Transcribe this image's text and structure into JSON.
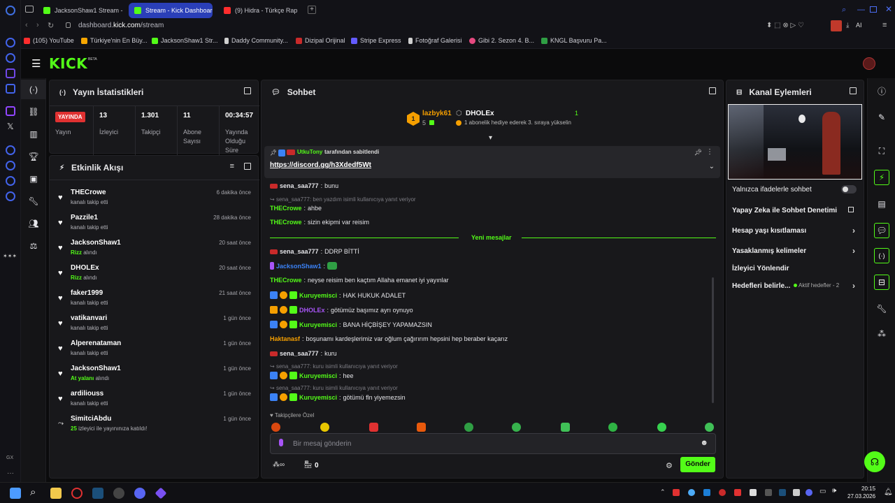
{
  "browser": {
    "tabs": [
      {
        "label": "JacksonShaw1 Stream - W",
        "fav_color": "#53fc18",
        "active": false
      },
      {
        "label": "Stream - Kick Dashboard",
        "fav_color": "#53fc18",
        "active": true
      },
      {
        "label": "(9) Hidra - Türkçe Rap",
        "fav_color": "#ff2d2d",
        "active": false
      }
    ],
    "url_prefix": "dashboard.",
    "url_domain": "kick.com",
    "url_path": "/stream",
    "bookmarks": [
      {
        "label": "(105) YouTube",
        "color": "#ff2d2d"
      },
      {
        "label": "Türkiye'nin En Büy...",
        "color": "#f7a600"
      },
      {
        "label": "JacksonShaw1 Str...",
        "color": "#53fc18"
      },
      {
        "label": "Daddy Community...",
        "color": "#d0d0d0"
      },
      {
        "label": "Dizipal Orijinal",
        "color": "#c92a2a"
      },
      {
        "label": "Stripe Express",
        "color": "#635bff"
      },
      {
        "label": "Fotoğraf Galerisi",
        "color": "#d0d0d0"
      },
      {
        "label": "Gibi 2. Sezon 4. B...",
        "color": "#e64980"
      },
      {
        "label": "KNGL Başvuru Pa...",
        "color": "#2f9e44"
      }
    ],
    "toolbar_ai": "AI"
  },
  "app": {
    "logo": "KICK",
    "logo_sup": "BETA"
  },
  "stats": {
    "title": "Yayın İstatistikleri",
    "live_badge": "YAYINDA",
    "live_label": "Yayın",
    "items": [
      {
        "value": "13",
        "label": "İzleyici"
      },
      {
        "value": "1.301",
        "label": "Takipçi"
      },
      {
        "value": "11",
        "label": "Abone Sayısı"
      },
      {
        "value": "00:34:57",
        "label": "Yayında Olduğu Süre"
      }
    ]
  },
  "activity": {
    "title": "Etkinlik Akışı",
    "items": [
      {
        "name": "THECrowe",
        "sub_pre": "",
        "sub_hl": "",
        "sub_post": "kanalı takip etti",
        "time": "6 dakika önce",
        "icon": "heart"
      },
      {
        "name": "Pazzile1",
        "sub_pre": "",
        "sub_hl": "",
        "sub_post": "kanalı takip etti",
        "time": "28 dakika önce",
        "icon": "heart"
      },
      {
        "name": "JacksonShaw1",
        "sub_pre": "",
        "sub_hl": "Rizz",
        "sub_post": " alındı",
        "time": "20 saat önce",
        "icon": "heart"
      },
      {
        "name": "DHOLEx",
        "sub_pre": "",
        "sub_hl": "Rizz",
        "sub_post": " alındı",
        "time": "20 saat önce",
        "icon": "heart"
      },
      {
        "name": "faker1999",
        "sub_pre": "",
        "sub_hl": "",
        "sub_post": "kanalı takip etti",
        "time": "21 saat önce",
        "icon": "heart"
      },
      {
        "name": "vatikanvari",
        "sub_pre": "",
        "sub_hl": "",
        "sub_post": "kanalı takip etti",
        "time": "1 gün önce",
        "icon": "heart"
      },
      {
        "name": "Alperenataman",
        "sub_pre": "",
        "sub_hl": "",
        "sub_post": "kanalı takip etti",
        "time": "1 gün önce",
        "icon": "heart"
      },
      {
        "name": "JacksonShaw1",
        "sub_pre": "",
        "sub_hl": "At yalanı",
        "sub_post": " alındı",
        "time": "1 gün önce",
        "icon": "heart"
      },
      {
        "name": "ardiliouss",
        "sub_pre": "",
        "sub_hl": "",
        "sub_post": "kanalı takip etti",
        "time": "1 gün önce",
        "icon": "heart"
      },
      {
        "name": "SimitciAbdu",
        "sub_pre": "",
        "sub_hl": "25",
        "sub_post": " izleyici ile yayınınıza katıldı!",
        "time": "1 gün önce",
        "icon": "raid"
      }
    ]
  },
  "chat": {
    "title": "Sohbet",
    "leaderboard": {
      "first_name": "lazbyk61",
      "first_rank": "1",
      "first_count": "5",
      "second_name": "DHOLEx",
      "second_count": "1",
      "second_sub": "1 abonelik hediye ederek 3. sıraya yükselin"
    },
    "pinned": {
      "by_user": "UtkuTony",
      "by_text": "tarafından sabitlendi",
      "link": "https://discord.gg/h3Xdedf5Wt"
    },
    "new_messages_label": "Yeni mesajlar",
    "followers_only": "Takipçilere Özel",
    "input_placeholder": "Bir mesaj gönderin",
    "points_count": "0",
    "send_label": "Gönder",
    "messages": [
      {
        "kind": "msg",
        "user": "sena_saa777",
        "color": "#e4e4e8",
        "text": "bunu"
      },
      {
        "kind": "reply",
        "text": "sena_saa777: ben yazdım isimli kullanıcıya yanıt veriyor"
      },
      {
        "kind": "msg",
        "user": "THECrowe",
        "color": "#53fc18",
        "text": "ahbe"
      },
      {
        "kind": "msg",
        "user": "THECrowe",
        "color": "#53fc18",
        "text": "sizin ekipmi var reisim"
      },
      {
        "kind": "msg",
        "user": "sena_saa777",
        "color": "#e4e4e8",
        "text": "DDRP BİTTİ"
      },
      {
        "kind": "msg",
        "user": "JacksonShaw1",
        "color": "#3b82f6",
        "text": ""
      },
      {
        "kind": "msg",
        "user": "THECrowe",
        "color": "#53fc18",
        "text": "neyse reisim ben kaçtım Allaha emanet iyi yayınlar"
      },
      {
        "kind": "msg",
        "user": "Kuruyemisci",
        "color": "#53fc18",
        "text": "HAK HUKUK ADALET"
      },
      {
        "kind": "msg",
        "user": "DHOLEx",
        "color": "#a855f7",
        "text": "götümüz başımız ayrı oynuyo"
      },
      {
        "kind": "msg",
        "user": "Kuruyemisci",
        "color": "#53fc18",
        "text": "BANA HİÇBİŞEY YAPAMAZSIN"
      },
      {
        "kind": "msg",
        "user": "Haktanasf",
        "color": "#f59f00",
        "text": "boşunamı kardeşlerimiz var oğlum çağırırım hepsini hep beraber kaçarız"
      },
      {
        "kind": "msg",
        "user": "sena_saa777",
        "color": "#e4e4e8",
        "text": "kuru"
      },
      {
        "kind": "reply",
        "text": "sena_saa777: kuru isimli kullanıcıya yanıt veriyor"
      },
      {
        "kind": "msg",
        "user": "Kuruyemisci",
        "color": "#53fc18",
        "text": "hee"
      },
      {
        "kind": "reply",
        "text": "sena_saa777: kuru isimli kullanıcıya yanıt veriyor"
      },
      {
        "kind": "msg",
        "user": "Kuruyemisci",
        "color": "#53fc18",
        "text": "götümü fln yiyemezsin"
      }
    ]
  },
  "channel_actions": {
    "title": "Kanal Eylemleri",
    "items": [
      {
        "label": "Yalnızca ifadelerle sohbet",
        "control": "toggle"
      },
      {
        "label": "Yapay Zeka ile Sohbet Denetimi",
        "control": "popout"
      },
      {
        "label": "Hesap yaşı kısıtlaması",
        "control": "chevron"
      },
      {
        "label": "Yasaklanmış kelimeler",
        "control": "chevron"
      },
      {
        "label": "İzleyici Yönlendir",
        "control": "none"
      },
      {
        "label": "Hedefleri belirle...",
        "control": "chevron",
        "extra": "Aktif hedefler - 2"
      }
    ]
  },
  "taskbar": {
    "time": "20:15",
    "date": "27.03.2026"
  }
}
